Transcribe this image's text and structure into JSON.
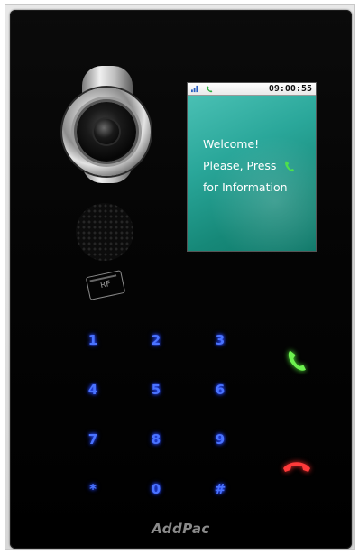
{
  "statusbar": {
    "time": "09:00:55",
    "icons": [
      "network-icon",
      "phone-icon"
    ]
  },
  "lcd": {
    "line1": "Welcome!",
    "line2": "Please, Press",
    "line3": "for Information",
    "accent": "#20a392"
  },
  "rf_label": "RF",
  "keypad": {
    "keys": [
      "1",
      "2",
      "3",
      "4",
      "5",
      "6",
      "7",
      "8",
      "9",
      "*",
      "0",
      "#"
    ],
    "color": "#4a73ff"
  },
  "call": {
    "icon": "call-phone-icon",
    "color": "#6df24f"
  },
  "end": {
    "icon": "end-call-icon",
    "color": "#ff3a3a"
  },
  "brand": "AddPac"
}
